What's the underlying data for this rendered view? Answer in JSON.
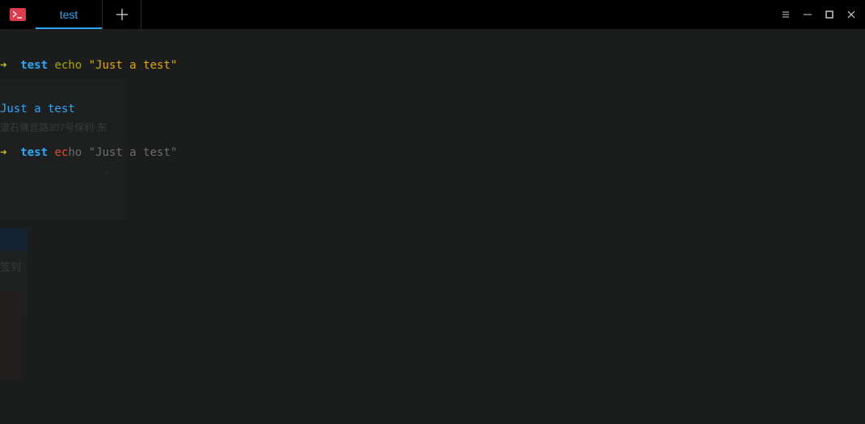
{
  "app": {
    "icon": "terminal-icon",
    "accent_color": "#2ca7f8",
    "icon_color": "#e03b4b"
  },
  "tabs": [
    {
      "label": "test",
      "active": true
    }
  ],
  "new_tab": {
    "icon": "plus-icon"
  },
  "window_controls": [
    {
      "name": "menu",
      "icon": "hamburger-icon"
    },
    {
      "name": "minimize",
      "icon": "minimize-icon"
    },
    {
      "name": "maximize",
      "icon": "maximize-icon"
    },
    {
      "name": "close",
      "icon": "close-icon"
    }
  ],
  "terminal": {
    "lines": [
      {
        "prompt_arrow": "➜",
        "dir": "test",
        "cmd": "echo",
        "arg": "\"Just a test\""
      },
      {
        "output": "Just a test"
      },
      {
        "prompt_arrow": "➜",
        "dir": "test",
        "typed": "ec",
        "suggestion": "ho \"Just a test\""
      }
    ]
  },
  "ghost": {
    "address_text": "道石佛营路307号保利·东",
    "sign_text": "签到",
    "chevron": "›"
  }
}
